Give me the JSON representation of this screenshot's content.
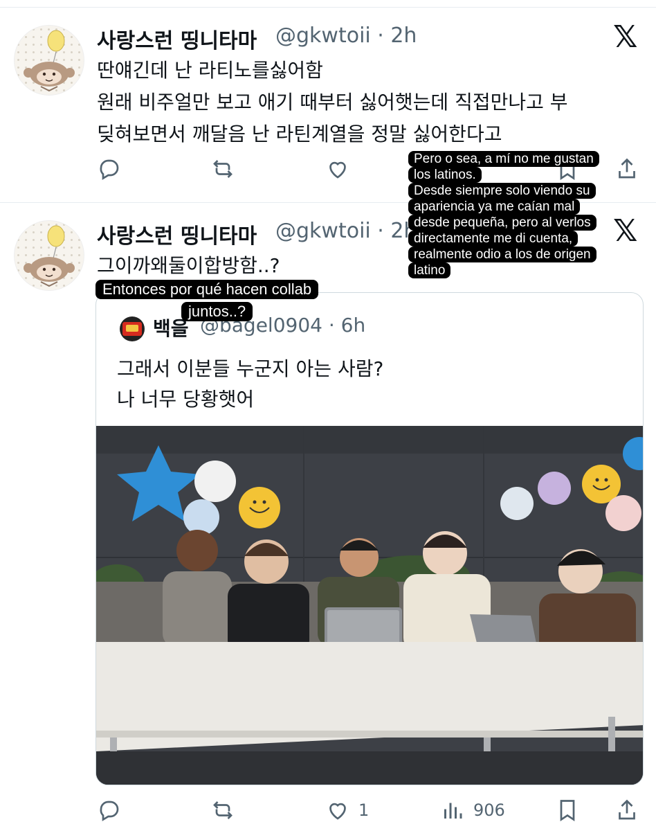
{
  "tweet1": {
    "display_name": "사랑스런 띵니타마",
    "handle_time": "@gkwtoii · 2h",
    "lines": [
      "딴얘긴데 난 라티노를싫어함",
      "원래 비주얼만 보고 애기 때부터 싫어햇는데 직접만나고 부",
      "딪혀보면서 깨달음 난 라틴계열을 정말 싫어한다고"
    ]
  },
  "tweet2": {
    "display_name": "사랑스런 띵니타마",
    "handle_time": "@gkwtoii · 2h",
    "lines": [
      "그이까왜둘이합방함..?"
    ],
    "likes": "1",
    "views": "906"
  },
  "quote": {
    "display_name": "백을",
    "handle_time": "@bagel0904 · 6h",
    "lines": [
      "그래서 이분들 누군지 아는 사람?",
      "나 너무 당황햇어"
    ]
  },
  "captions": {
    "right": [
      "Pero o sea, a mí no me gustan",
      "los latinos.",
      "Desde siempre solo viendo su",
      "apariencia ya me caían mal",
      "desde pequeña, pero al verlos",
      "directamente me di cuenta,",
      "realmente odio a los de origen",
      "latino"
    ],
    "left": [
      "Entonces por qué hacen collab",
      "juntos..?"
    ]
  },
  "colors": {
    "text": "#0f1419",
    "secondary": "#536471",
    "border": "#cfd9de",
    "caption_bg": "#000000",
    "caption_text": "#ffffff"
  },
  "icons": [
    "reply-icon",
    "retweet-icon",
    "like-icon",
    "views-icon",
    "bookmark-icon",
    "share-icon",
    "x-logo-icon"
  ]
}
